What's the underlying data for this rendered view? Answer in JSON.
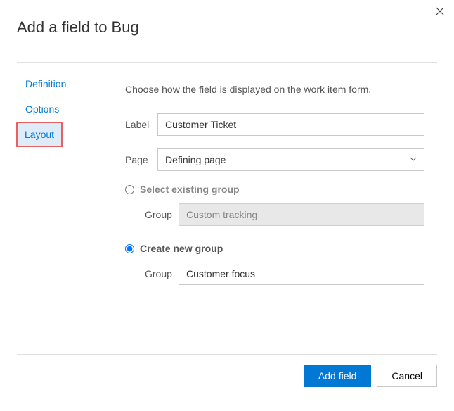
{
  "dialog": {
    "title": "Add a field to Bug",
    "tabs": {
      "definition": "Definition",
      "options": "Options",
      "layout": "Layout"
    },
    "panel": {
      "intro": "Choose how the field is displayed on the work item form.",
      "label_field": "Label",
      "label_value": "Customer Ticket",
      "page_field": "Page",
      "page_value": "Defining page",
      "radio_existing": "Select existing group",
      "existing_group_label": "Group",
      "existing_group_value": "Custom tracking",
      "radio_new": "Create new group",
      "new_group_label": "Group",
      "new_group_value": "Customer focus"
    },
    "footer": {
      "primary": "Add field",
      "cancel": "Cancel"
    }
  }
}
